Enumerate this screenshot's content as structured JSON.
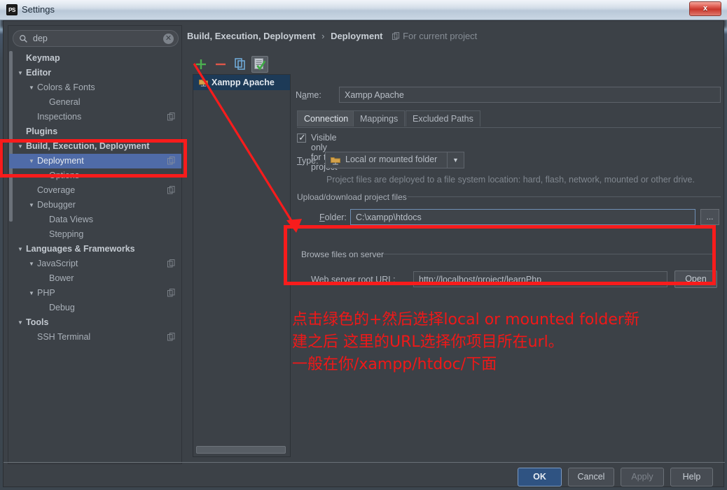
{
  "window": {
    "title": "Settings",
    "app_icon": "ps-icon",
    "close_label": "x"
  },
  "sidebar": {
    "search": {
      "value": "dep",
      "placeholder": "",
      "icon": "search-icon",
      "clear_icon": "clear-icon"
    },
    "items": [
      {
        "label": "Keymap",
        "indent": 24,
        "arrow": "",
        "bold": true,
        "selected": false,
        "copy": false
      },
      {
        "label": "Editor",
        "indent": 24,
        "arrow": "▼",
        "bold": true,
        "selected": false,
        "copy": false
      },
      {
        "label": "Colors & Fonts",
        "indent": 40,
        "arrow": "▼",
        "bold": false,
        "selected": false,
        "copy": false
      },
      {
        "label": "General",
        "indent": 57,
        "arrow": "",
        "bold": false,
        "selected": false,
        "copy": false
      },
      {
        "label": "Inspections",
        "indent": 40,
        "arrow": "",
        "bold": false,
        "selected": false,
        "copy": true
      },
      {
        "label": "Plugins",
        "indent": 24,
        "arrow": "",
        "bold": true,
        "selected": false,
        "copy": false
      },
      {
        "label": "Build, Execution, Deployment",
        "indent": 24,
        "arrow": "▼",
        "bold": true,
        "selected": false,
        "copy": false
      },
      {
        "label": "Deployment",
        "indent": 40,
        "arrow": "▼",
        "bold": false,
        "selected": true,
        "copy": true
      },
      {
        "label": "Options",
        "indent": 57,
        "arrow": "",
        "bold": false,
        "selected": false,
        "copy": false
      },
      {
        "label": "Coverage",
        "indent": 40,
        "arrow": "",
        "bold": false,
        "selected": false,
        "copy": true
      },
      {
        "label": "Debugger",
        "indent": 40,
        "arrow": "▼",
        "bold": false,
        "selected": false,
        "copy": false
      },
      {
        "label": "Data Views",
        "indent": 57,
        "arrow": "",
        "bold": false,
        "selected": false,
        "copy": false
      },
      {
        "label": "Stepping",
        "indent": 57,
        "arrow": "",
        "bold": false,
        "selected": false,
        "copy": false
      },
      {
        "label": "Languages & Frameworks",
        "indent": 24,
        "arrow": "▼",
        "bold": true,
        "selected": false,
        "copy": false
      },
      {
        "label": "JavaScript",
        "indent": 40,
        "arrow": "▼",
        "bold": false,
        "selected": false,
        "copy": true
      },
      {
        "label": "Bower",
        "indent": 57,
        "arrow": "",
        "bold": false,
        "selected": false,
        "copy": false
      },
      {
        "label": "PHP",
        "indent": 40,
        "arrow": "▼",
        "bold": false,
        "selected": false,
        "copy": true
      },
      {
        "label": "Debug",
        "indent": 57,
        "arrow": "",
        "bold": false,
        "selected": false,
        "copy": false
      },
      {
        "label": "Tools",
        "indent": 24,
        "arrow": "▼",
        "bold": true,
        "selected": false,
        "copy": false
      },
      {
        "label": "SSH Terminal",
        "indent": 40,
        "arrow": "",
        "bold": false,
        "selected": false,
        "copy": true
      }
    ]
  },
  "main": {
    "breadcrumb_root": "Build, Execution, Deployment",
    "breadcrumb_sep": "›",
    "breadcrumb_leaf": "Deployment",
    "scope_text": "For current project",
    "toolbar": {
      "add_label": "+",
      "remove_label": "−",
      "copy_label": "copy-icon",
      "default_label": "set-default-icon"
    },
    "servers": [
      {
        "label": "Xampp Apache",
        "selected": true
      }
    ],
    "name_label": "Name:",
    "name_value": "Xampp Apache",
    "tabs": [
      {
        "label": "Connection",
        "active": true
      },
      {
        "label": "Mappings",
        "active": false
      },
      {
        "label": "Excluded Paths",
        "active": false
      }
    ],
    "visible_only_label": "Visible only for this project",
    "visible_only_checked": true,
    "type_label": "Type:",
    "type_value": "Local or mounted folder",
    "type_hint": "Project files are deployed to a file system location: hard, flash, network, mounted or other drive.",
    "upload_group_label": "Upload/download project files",
    "folder_label": "Folder:",
    "folder_value": "C:\\xampp\\htdocs",
    "folder_browse_label": "...",
    "browse_group_label": "Browse files on server",
    "web_url_label": "Web server root URL:",
    "web_url_value": "http://localhost/project/learnPhp",
    "open_label": "Open"
  },
  "annotation": {
    "line1": "点击绿色的+然后选择local or mounted folder新",
    "line2": "建之后 这里的URL选择你项目所在url。",
    "line3": "一般在你/xampp/htdoc/下面",
    "color": "#f01818"
  },
  "buttons": {
    "ok": "OK",
    "cancel": "Cancel",
    "apply": "Apply",
    "help": "Help"
  },
  "highlight_color": "#f81c1c"
}
